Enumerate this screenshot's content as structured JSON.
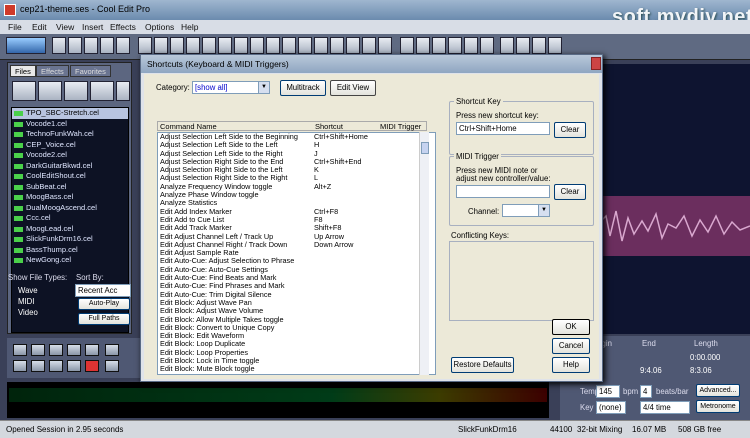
{
  "app": {
    "title": "cep21-theme.ses - Cool Edit Pro",
    "watermark": "soft.mydiv.net"
  },
  "menu": [
    "File",
    "Edit",
    "View",
    "Insert",
    "Effects",
    "Options",
    "Help"
  ],
  "left": {
    "tabs": [
      "Files",
      "Effects",
      "Favorites"
    ],
    "files": [
      "TPO_SBC-Stretch.cel",
      "Vocode1.cel",
      "TechnoFunkWah.cel",
      "CEP_Voice.cel",
      "Vocode2.cel",
      "DarkGuitarBkwd.cel",
      "CoolEditShout.cel",
      "SubBeat.cel",
      "MoogBass.cel",
      "DualMoogAscend.cel",
      "Ccc.cel",
      "MoogLead.cel",
      "SlickFunkDrm16.cel",
      "BassThump.cel",
      "NewGong.cel"
    ],
    "show_file_types": "Show File Types:",
    "sort_by": "Sort By:",
    "sort_value": "Recent Acc",
    "types": [
      "Wave",
      "MIDI",
      "Video"
    ],
    "auto_play": "Auto-Play",
    "full_paths": "Full Paths"
  },
  "dialog": {
    "title": "Shortcuts (Keyboard & MIDI Triggers)",
    "category_label": "Category:",
    "category_value": "[show all]",
    "multitrack": "Multitrack",
    "edit_view": "Edit View",
    "columns": [
      "Command Name",
      "Shortcut",
      "MIDI Trigger"
    ],
    "rows": [
      [
        "Adjust Selection Left Side to the Beginning",
        "Ctrl+Shift+Home"
      ],
      [
        "Adjust Selection Left Side to the Left",
        "H"
      ],
      [
        "Adjust Selection Left Side to the Right",
        "J"
      ],
      [
        "Adjust Selection Right Side to the End",
        "Ctrl+Shift+End"
      ],
      [
        "Adjust Selection Right Side to the Left",
        "K"
      ],
      [
        "Adjust Selection Right Side to the Right",
        "L"
      ],
      [
        "Analyze Frequency Window toggle",
        "Alt+Z"
      ],
      [
        "Analyze Phase Window toggle",
        ""
      ],
      [
        "Analyze Statistics",
        ""
      ],
      [
        "Edit Add Index Marker",
        "Ctrl+F8"
      ],
      [
        "Edit Add to Cue List",
        "F8"
      ],
      [
        "Edit Add Track Marker",
        "Shift+F8"
      ],
      [
        "Edit Adjust Channel Left / Track Up",
        "Up Arrow"
      ],
      [
        "Edit Adjust Channel Right / Track Down",
        "Down Arrow"
      ],
      [
        "Edit Adjust Sample Rate",
        ""
      ],
      [
        "Edit Auto-Cue: Adjust Selection to Phrase",
        ""
      ],
      [
        "Edit Auto-Cue: Auto-Cue Settings",
        ""
      ],
      [
        "Edit Auto-Cue: Find Beats and Mark",
        ""
      ],
      [
        "Edit Auto-Cue: Find Phrases and Mark",
        ""
      ],
      [
        "Edit Auto-Cue: Trim Digital Silence",
        ""
      ],
      [
        "Edit Block: Adjust Wave Pan",
        ""
      ],
      [
        "Edit Block: Adjust Wave Volume",
        ""
      ],
      [
        "Edit Block: Allow Multiple Takes toggle",
        ""
      ],
      [
        "Edit Block: Convert to Unique Copy",
        ""
      ],
      [
        "Edit Block: Edit Waveform",
        ""
      ],
      [
        "Edit Block: Loop Duplicate",
        ""
      ],
      [
        "Edit Block: Loop Properties",
        ""
      ],
      [
        "Edit Block: Lock in Time toggle",
        ""
      ],
      [
        "Edit Block: Mute Block toggle",
        ""
      ]
    ],
    "shortcut_key": {
      "group": "Shortcut Key",
      "prompt": "Press new shortcut key:",
      "value": "Ctrl+Shift+Home",
      "clear": "Clear"
    },
    "midi": {
      "group": "MIDI Trigger",
      "prompt1": "Press new MIDI note or",
      "prompt2": "adjust new controller/value:",
      "clear": "Clear",
      "channel": "Channel:"
    },
    "conflicting": "Conflicting Keys:",
    "restore": "Restore Defaults",
    "ok": "OK",
    "cancel": "Cancel",
    "help": "Help"
  },
  "right": {
    "begin": "Begin",
    "end": "End",
    "length": "Length",
    "v1": "0:00.000",
    "v2": "0:00.000",
    "v3": "9:4.06",
    "v4": "8:3.06",
    "tempo": "Tempo",
    "tempo_val": "145",
    "bpm": "bpm",
    "beats_val": "4",
    "beats_bar": "beats/bar",
    "advanced": "Advanced...",
    "key": "Key",
    "key_val": "(none)",
    "time_sig": "4/4 time",
    "metronome": "Metronome"
  },
  "status": {
    "open": "Opened Session in 2.95 seconds",
    "file": "SlickFunkDrm16",
    "rate": "44100",
    "depth": "32-bit Mixing",
    "mem": "16.07 MB",
    "free": "508 GB free"
  }
}
